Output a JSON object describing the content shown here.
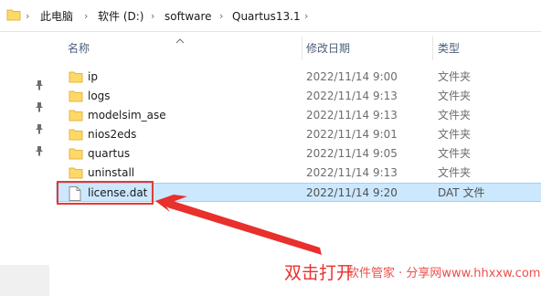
{
  "addressbar": {
    "breadcrumbs": [
      "此电脑",
      "软件 (D:)",
      "software",
      "Quartus13.1"
    ],
    "separator": "›",
    "dropdown": "⌄"
  },
  "columns": {
    "name": "名称",
    "modified": "修改日期",
    "type": "类型"
  },
  "files": [
    {
      "name": "ip",
      "modified": "2022/11/14 9:00",
      "type": "文件夹",
      "icon": "folder-icon"
    },
    {
      "name": "logs",
      "modified": "2022/11/14 9:13",
      "type": "文件夹",
      "icon": "folder-icon"
    },
    {
      "name": "modelsim_ase",
      "modified": "2022/11/14 9:13",
      "type": "文件夹",
      "icon": "folder-icon"
    },
    {
      "name": "nios2eds",
      "modified": "2022/11/14 9:01",
      "type": "文件夹",
      "icon": "folder-icon"
    },
    {
      "name": "quartus",
      "modified": "2022/11/14 9:05",
      "type": "文件夹",
      "icon": "folder-icon"
    },
    {
      "name": "uninstall",
      "modified": "2022/11/14 9:13",
      "type": "文件夹",
      "icon": "folder-icon"
    },
    {
      "name": "license.dat",
      "modified": "2022/11/14 9:20",
      "type": "DAT 文件",
      "icon": "file-icon",
      "selected": true
    }
  ],
  "annotation": {
    "caption": "双击打开",
    "watermark": "软件管家 · 分享网www.hhxxw.com",
    "color": "#e8302c"
  },
  "colors": {
    "selection": "#cce8ff",
    "selection_border": "#99d1ff",
    "folder": "#ffd966",
    "header_text": "#4c607a"
  }
}
